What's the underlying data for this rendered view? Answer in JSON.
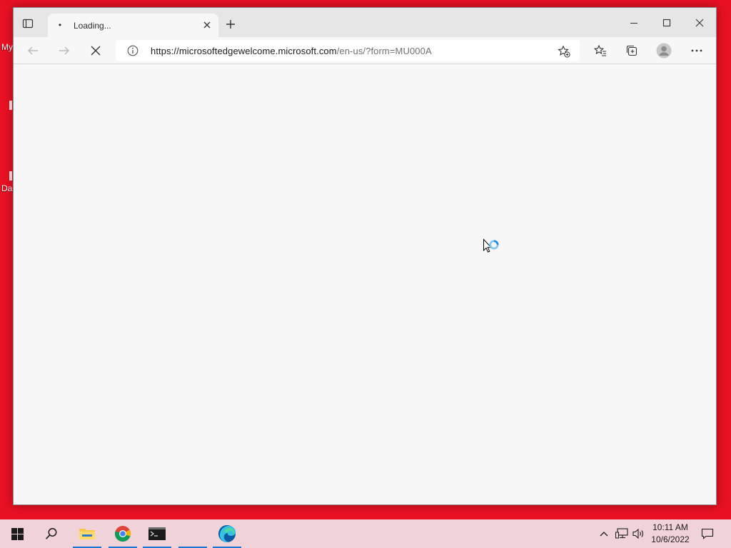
{
  "desktop": {
    "label_fragments": [
      "My",
      "Da"
    ]
  },
  "browser": {
    "tab": {
      "title": "Loading...",
      "favicon_text": "•"
    },
    "address": {
      "url_host": "https://microsoftedgewelcome.microsoft.com",
      "url_path": "/en-us/?form=MU000A"
    },
    "toolbar_icons": [
      "back-icon",
      "forward-icon",
      "stop-icon",
      "site-info-icon",
      "add-favorite-icon",
      "favorites-icon",
      "collections-icon",
      "profile-icon",
      "more-icon"
    ]
  },
  "taskbar": {
    "pinned": [
      "start-icon",
      "search-icon",
      "file-explorer-icon",
      "chrome-icon",
      "terminal-icon",
      "edge-icon"
    ],
    "clock": {
      "time": "10:11 AM",
      "date": "10/6/2022"
    }
  },
  "colors": {
    "desktop_bg": "#e81123",
    "taskbar_bg": "#f0d3d8",
    "accent": "#1976d2"
  }
}
